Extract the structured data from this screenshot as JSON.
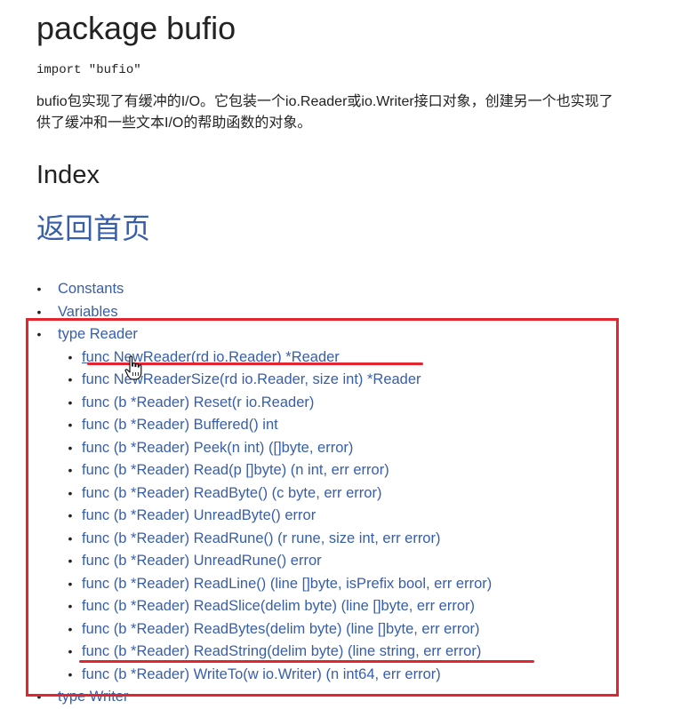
{
  "package": {
    "title": "package bufio",
    "import_line": "import \"bufio\"",
    "description_lines": [
      "bufio包实现了有缓冲的I/O。它包装一个io.Reader或io.Writer接口对象，创建另一个也实现了",
      "供了缓冲和一些文本I/O的帮助函数的对象。"
    ]
  },
  "index": {
    "title": "Index",
    "home_link": "返回首页",
    "items": [
      {
        "level": 0,
        "label": "Constants"
      },
      {
        "level": 0,
        "label": "Variables"
      },
      {
        "level": 0,
        "label": "type Reader"
      },
      {
        "level": 1,
        "label": "func NewReader(rd io.Reader) *Reader",
        "underlined": true
      },
      {
        "level": 1,
        "label": "func NewReaderSize(rd io.Reader, size int) *Reader"
      },
      {
        "level": 1,
        "label": "func (b *Reader) Reset(r io.Reader)"
      },
      {
        "level": 1,
        "label": "func (b *Reader) Buffered() int"
      },
      {
        "level": 1,
        "label": "func (b *Reader) Peek(n int) ([]byte, error)"
      },
      {
        "level": 1,
        "label": "func (b *Reader) Read(p []byte) (n int, err error)"
      },
      {
        "level": 1,
        "label": "func (b *Reader) ReadByte() (c byte, err error)"
      },
      {
        "level": 1,
        "label": "func (b *Reader) UnreadByte() error"
      },
      {
        "level": 1,
        "label": "func (b *Reader) ReadRune() (r rune, size int, err error)"
      },
      {
        "level": 1,
        "label": "func (b *Reader) UnreadRune() error"
      },
      {
        "level": 1,
        "label": "func (b *Reader) ReadLine() (line []byte, isPrefix bool, err error)"
      },
      {
        "level": 1,
        "label": "func (b *Reader) ReadSlice(delim byte) (line []byte, err error)"
      },
      {
        "level": 1,
        "label": "func (b *Reader) ReadBytes(delim byte) (line []byte, err error)"
      },
      {
        "level": 1,
        "label": "func (b *Reader) ReadString(delim byte) (line string, err error)"
      },
      {
        "level": 1,
        "label": "func (b *Reader) WriteTo(w io.Writer) (n int64, err error)"
      },
      {
        "level": 0,
        "label": "type Writer"
      }
    ]
  },
  "colors": {
    "link": "#375eab",
    "text": "#222222",
    "annotation": "#e32530"
  },
  "icons": {
    "cursor": "hand-pointer-icon"
  }
}
